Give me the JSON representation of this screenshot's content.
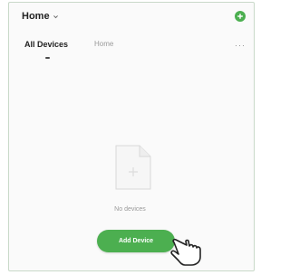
{
  "header": {
    "home_label": "Home"
  },
  "tabs": [
    {
      "label": "All Devices",
      "active": true
    },
    {
      "label": "Home",
      "active": false
    }
  ],
  "empty_state": {
    "message": "No devices"
  },
  "actions": {
    "add_device_label": "Add Device"
  },
  "colors": {
    "accent": "#4caf50"
  },
  "icons": [
    "chevron-down-icon",
    "add-icon",
    "more-icon",
    "empty-file-icon",
    "pointing-hand-icon"
  ]
}
